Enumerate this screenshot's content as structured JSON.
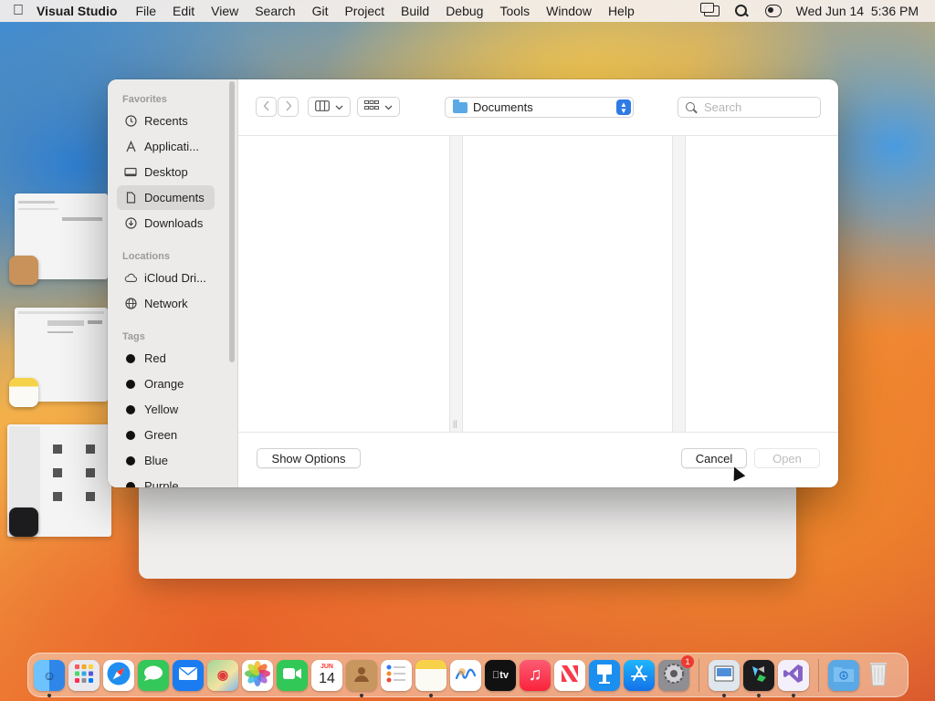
{
  "menubar": {
    "app_name": "Visual Studio",
    "items": [
      "File",
      "Edit",
      "View",
      "Search",
      "Git",
      "Project",
      "Build",
      "Debug",
      "Tools",
      "Window",
      "Help"
    ],
    "datetime": "Wed Jun 14  5:36 PM"
  },
  "dialog": {
    "sidebar": {
      "favorites_heading": "Favorites",
      "favorites": [
        {
          "label": "Recents",
          "icon": "clock-icon"
        },
        {
          "label": "Applicati...",
          "icon": "applications-icon"
        },
        {
          "label": "Desktop",
          "icon": "desktop-icon"
        },
        {
          "label": "Documents",
          "icon": "document-icon",
          "selected": true
        },
        {
          "label": "Downloads",
          "icon": "download-icon"
        }
      ],
      "locations_heading": "Locations",
      "locations": [
        {
          "label": "iCloud Dri...",
          "icon": "cloud-icon"
        },
        {
          "label": "Network",
          "icon": "globe-icon"
        }
      ],
      "tags_heading": "Tags",
      "tags": [
        {
          "label": "Red"
        },
        {
          "label": "Orange"
        },
        {
          "label": "Yellow"
        },
        {
          "label": "Green"
        },
        {
          "label": "Blue"
        },
        {
          "label": "Purple"
        }
      ]
    },
    "toolbar": {
      "location": "Documents",
      "search_placeholder": "Search"
    },
    "footer": {
      "show_options": "Show Options",
      "cancel": "Cancel",
      "open": "Open"
    }
  },
  "dock": {
    "calendar_month": "JUN",
    "calendar_day": "14",
    "settings_badge": "1",
    "apps": [
      "Finder",
      "Launchpad",
      "Safari",
      "Messages",
      "Mail",
      "Maps",
      "Photos",
      "FaceTime",
      "Calendar",
      "Contacts",
      "Reminders",
      "Notes",
      "Freeform",
      "TV",
      "Music",
      "News",
      "Keynote",
      "App Store",
      "System Settings",
      "Preview",
      "Xcode Simulator",
      "Visual Studio",
      "Downloads",
      "Trash"
    ]
  }
}
